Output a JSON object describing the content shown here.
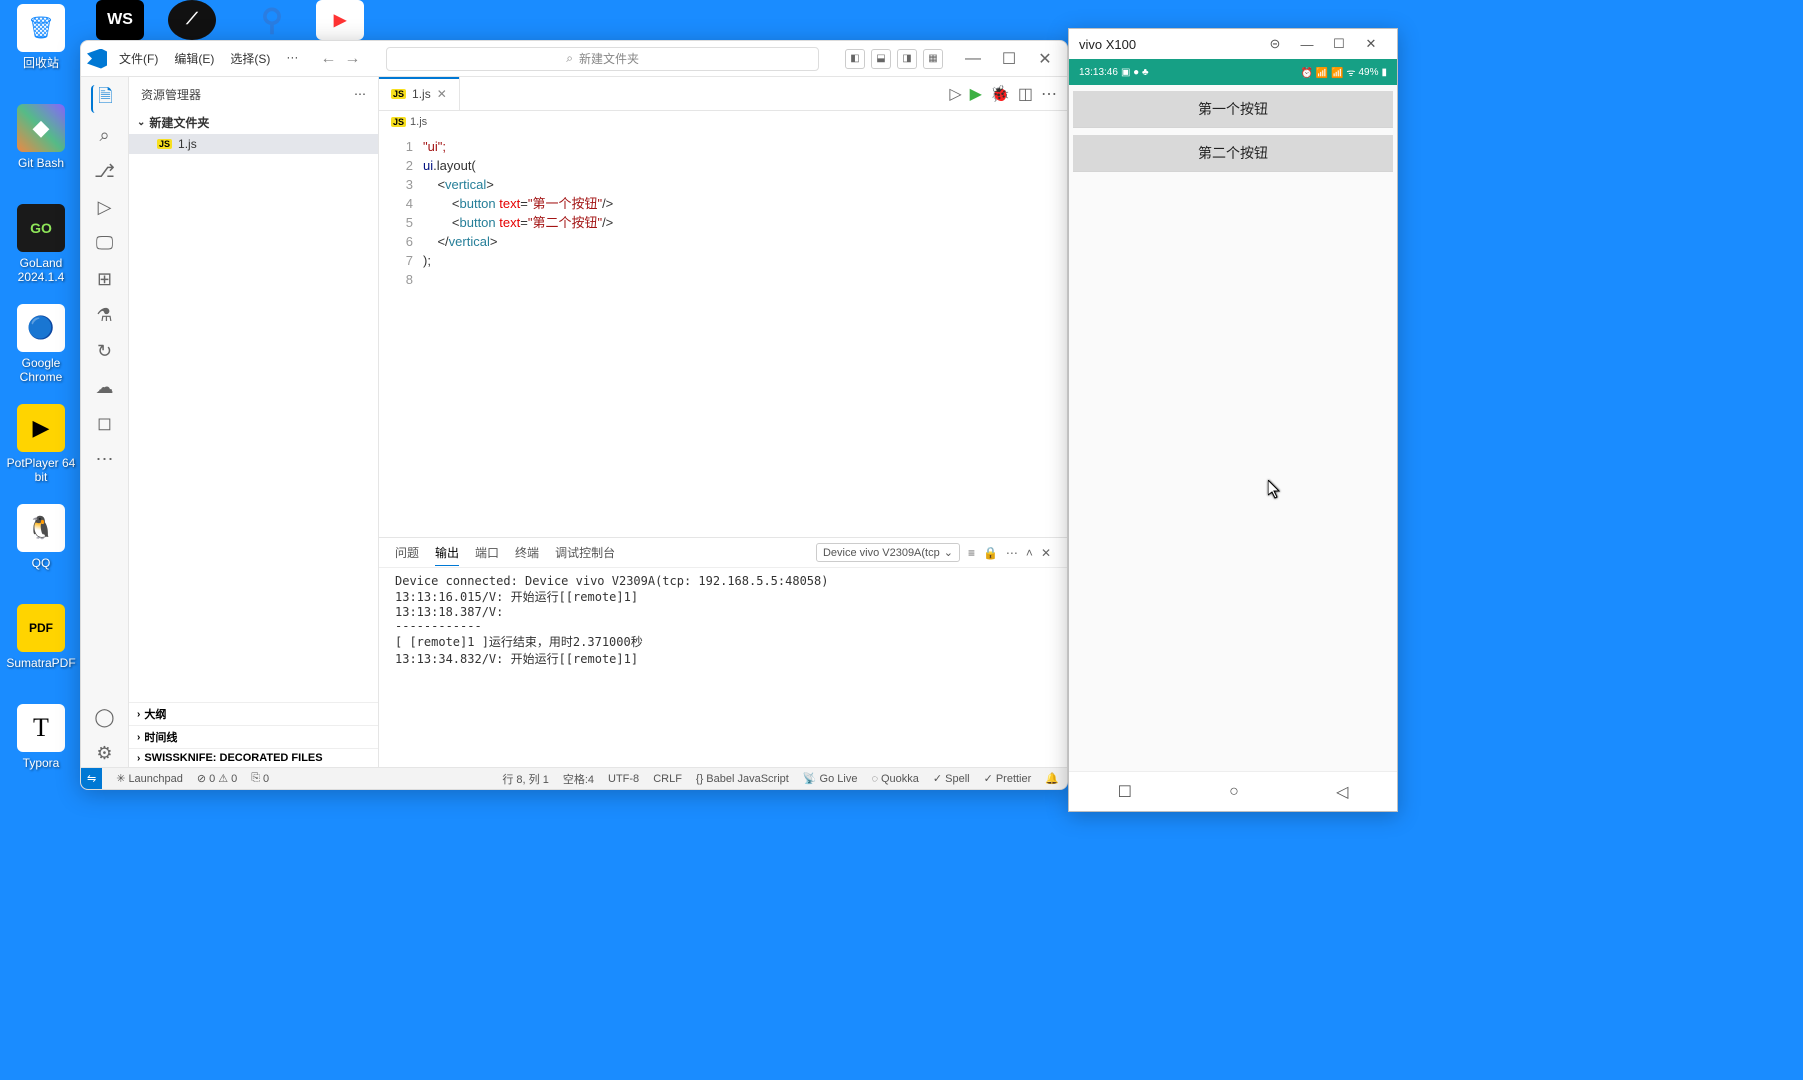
{
  "desktop": {
    "icons": [
      {
        "label": "回收站",
        "bg": "#fff",
        "glyph": "🗑"
      },
      {
        "label": "Git Bash",
        "bg": "#f7a64a",
        "glyph": "◆"
      },
      {
        "label": "GoLand 2024.1.4",
        "bg": "#28282c",
        "glyph": "GO"
      },
      {
        "label": "Google Chrome",
        "bg": "#fff",
        "glyph": "◉"
      },
      {
        "label": "PotPlayer 64 bit",
        "bg": "#ffd400",
        "glyph": "▶"
      },
      {
        "label": "QQ",
        "bg": "#fff",
        "glyph": "🐧"
      },
      {
        "label": "SumatraPDF",
        "bg": "#ffd400",
        "glyph": "PDF"
      },
      {
        "label": "Typora",
        "bg": "#fff",
        "glyph": "T"
      }
    ],
    "top_apps": [
      {
        "bg": "#000",
        "txt": "WS"
      },
      {
        "bg": "#111",
        "txt": "⟋"
      },
      {
        "bg": "#3b82f6",
        "txt": "⚲"
      },
      {
        "bg": "#fff",
        "txt": "▶"
      }
    ]
  },
  "vscode": {
    "menu": [
      "文件(F)",
      "编辑(E)",
      "选择(S)",
      "···"
    ],
    "search_placeholder": "新建文件夹",
    "explorer_title": "资源管理器",
    "folder": "新建文件夹",
    "file": "1.js",
    "sections": [
      "大纲",
      "时间线",
      "SWISSKNIFE: DECORATED FILES"
    ],
    "tab": {
      "name": "1.js"
    },
    "breadcrumb": "1.js",
    "code": {
      "lines": 8,
      "l1": "\"ui\";",
      "l2_a": "ui",
      "l2_b": ".layout(",
      "l3_a": "    <",
      "l3_b": "vertical",
      "l3_c": ">",
      "l4_a": "        <",
      "l4_b": "button",
      "l4_c": " text",
      "l4_d": "=",
      "l4_e": "\"第一个按钮\"",
      "l4_f": "/>",
      "l5_a": "        <",
      "l5_b": "button",
      "l5_c": " text",
      "l5_d": "=",
      "l5_e": "\"第二个按钮\"",
      "l5_f": "/>",
      "l6_a": "    </",
      "l6_b": "vertical",
      "l6_c": ">",
      "l7": ");"
    },
    "panel": {
      "tabs": [
        "问题",
        "输出",
        "端口",
        "终端",
        "调试控制台"
      ],
      "active_tab": "输出",
      "select": "Device vivo V2309A(tcp",
      "output": "Device connected: Device vivo V2309A(tcp: 192.168.5.5:48058)\n13:13:16.015/V: 开始运行[[remote]1]\n13:13:18.387/V:\n------------\n[ [remote]1 ]运行结束，用时2.371000秒\n13:13:34.832/V: 开始运行[[remote]1]"
    },
    "status": {
      "launchpad": "Launchpad",
      "errors": "0",
      "warnings": "0",
      "port": "0",
      "pos": "行 8, 列 1",
      "spaces": "空格:4",
      "enc": "UTF-8",
      "eol": "CRLF",
      "lang": "Babel JavaScript",
      "golive": "Go Live",
      "quokka": "Quokka",
      "spell": "Spell",
      "prettier": "Prettier"
    }
  },
  "phone": {
    "title": "vivo X100",
    "time": "13:13:46",
    "battery": "49%",
    "buttons": [
      "第一个按钮",
      "第二个按钮"
    ]
  }
}
